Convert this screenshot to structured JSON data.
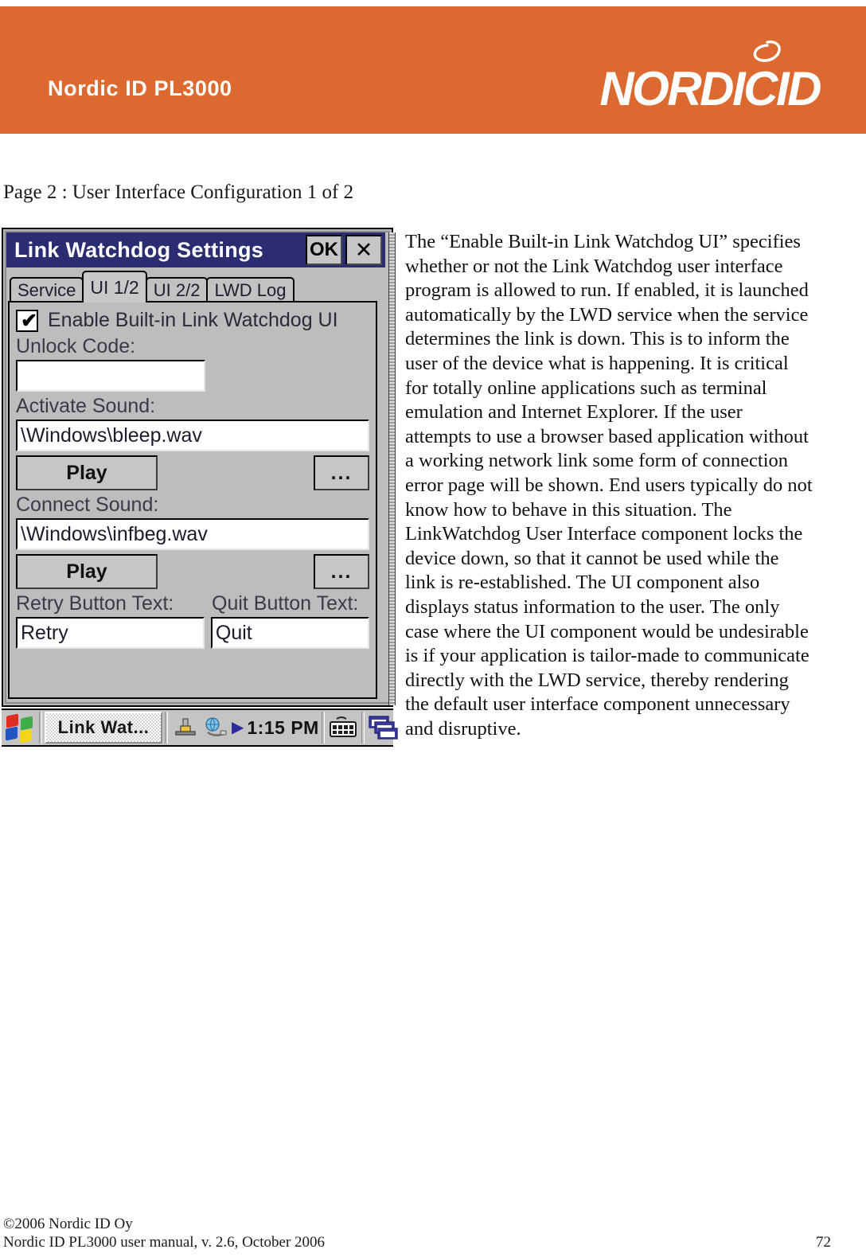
{
  "header": {
    "product_title": "Nordic ID PL3000",
    "logo_text": "NORDICID",
    "logo_icon": "swirl-loop-icon",
    "background_color": "#dc6a30"
  },
  "page_caption": "Page 2 : User Interface Configuration 1 of 2",
  "device_screenshot": {
    "window": {
      "title": "Link Watchdog Settings",
      "titlebar_color": "#2c2c72",
      "ok_button": "OK",
      "close_button": "✕"
    },
    "tabs": [
      {
        "label": "Service",
        "active": false
      },
      {
        "label": "UI 1/2",
        "active": true
      },
      {
        "label": "UI 2/2",
        "active": false
      },
      {
        "label": "LWD Log",
        "active": false
      }
    ],
    "form": {
      "enable_checkbox": {
        "label": "Enable Built-in Link Watchdog UI",
        "checked": true,
        "tick_glyph": "✔"
      },
      "unlock_code": {
        "label": "Unlock Code:",
        "value": "",
        "placeholder": ""
      },
      "activate_sound": {
        "label": "Activate Sound:",
        "value": "\\Windows\\bleep.wav",
        "play_button": "Play",
        "browse_button": "..."
      },
      "connect_sound": {
        "label": "Connect Sound:",
        "value": "\\Windows\\infbeg.wav",
        "play_button": "Play",
        "browse_button": "..."
      },
      "retry_button_text": {
        "label": "Retry Button Text:",
        "value": "Retry"
      },
      "quit_button_text": {
        "label": "Quit Button Text:",
        "value": "Quit"
      }
    },
    "taskbar": {
      "start_icon": "windows-start-flag-icon",
      "task_button_label": "Link Wat...",
      "tray_icons": [
        "padlock-icon",
        "network-globe-icon"
      ],
      "tray_arrow": "▶",
      "clock": "1:15 PM",
      "sip_icon": "keyboard-icon",
      "windows_icon": "cascading-windows-icon"
    }
  },
  "body_text": "The “Enable Built-in Link Watchdog UI” specifies whether or not the Link Watchdog user interface program is allowed to run. If enabled, it is launched automatically by the LWD service when the service determines the link is down. This is to inform the user of the device what is happening. It is critical for totally online applications such as terminal emulation and Internet Explorer. If the user attempts to use a browser based application without a working network link some form of connection error page will be shown. End users typically do not know how to behave in this situation. The LinkWatchdog User Interface component locks the device down, so that it cannot be used while the link is re-established. The UI component also displays status information to the user. The only case where the UI component would be undesirable is if your application is tailor-made to communicate directly with the LWD service, thereby rendering the default user interface component unnecessary and disruptive.",
  "footer": {
    "copyright": "©2006 Nordic ID Oy",
    "manual_line": "Nordic ID PL3000 user manual, v. 2.6, October 2006",
    "page_number": "72"
  }
}
